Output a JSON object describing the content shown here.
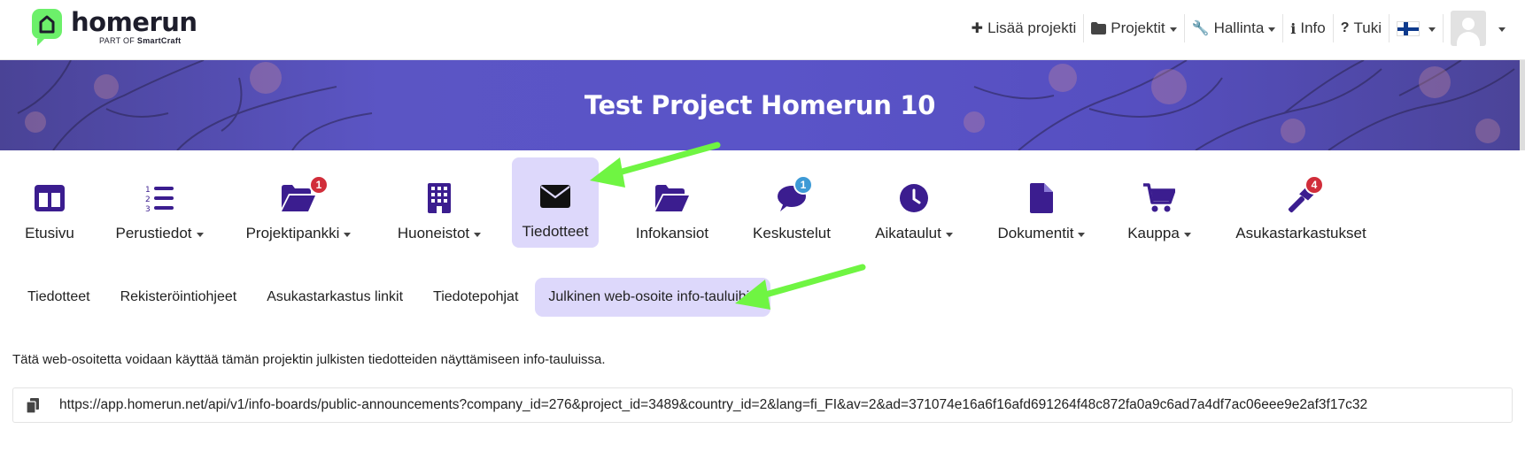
{
  "brand": {
    "name": "homerun",
    "sub_prefix": "PART OF",
    "sub_brand": "SmartCraft"
  },
  "topnav": {
    "add_project": "Lisää projekti",
    "projects": "Projektit",
    "admin": "Hallinta",
    "info": "Info",
    "support": "Tuki"
  },
  "banner": {
    "title": "Test Project Homerun 10"
  },
  "modules": [
    {
      "label": "Etusivu",
      "icon": "layout-columns-icon",
      "dropdown": false
    },
    {
      "label": "Perustiedot",
      "icon": "numbered-list-icon",
      "dropdown": true
    },
    {
      "label": "Projektipankki",
      "icon": "folder-open-icon",
      "dropdown": true,
      "badge": "1"
    },
    {
      "label": "Huoneistot",
      "icon": "building-icon",
      "dropdown": true
    },
    {
      "label": "Tiedotteet",
      "icon": "envelope-icon",
      "dropdown": false,
      "active": true
    },
    {
      "label": "Infokansiot",
      "icon": "folder-open-icon",
      "dropdown": false
    },
    {
      "label": "Keskustelut",
      "icon": "chat-bubble-icon",
      "dropdown": false,
      "badge": "1"
    },
    {
      "label": "Aikataulut",
      "icon": "clock-icon",
      "dropdown": true
    },
    {
      "label": "Dokumentit",
      "icon": "file-icon",
      "dropdown": true
    },
    {
      "label": "Kauppa",
      "icon": "cart-icon",
      "dropdown": true
    },
    {
      "label": "Asukastarkastukset",
      "icon": "hammer-icon",
      "dropdown": false,
      "badge": "4"
    }
  ],
  "subtabs": [
    {
      "label": "Tiedotteet"
    },
    {
      "label": "Rekisteröintiohjeet"
    },
    {
      "label": "Asukastarkastus linkit"
    },
    {
      "label": "Tiedotepohjat"
    },
    {
      "label": "Julkinen web-osoite info-tauluihin",
      "active": true
    }
  ],
  "content": {
    "description": "Tätä web-osoitetta voidaan käyttää tämän projektin julkisten tiedotteiden näyttämiseen info-tauluissa.",
    "url": "https://app.homerun.net/api/v1/info-boards/public-announcements?company_id=276&project_id=3489&country_id=2&lang=fi_FI&av=2&ad=371074e16a6f16afd691264f48c872fa0a9c6ad7a4df7ac06eee9e2af3f17c32"
  },
  "colors": {
    "accent": "#3b1d8f",
    "active_bg": "#ddd8fb",
    "badge_red": "#d12d3a",
    "badge_blue": "#3d9ad6",
    "arrow": "#6ff542",
    "logo_green": "#6cf06a"
  }
}
